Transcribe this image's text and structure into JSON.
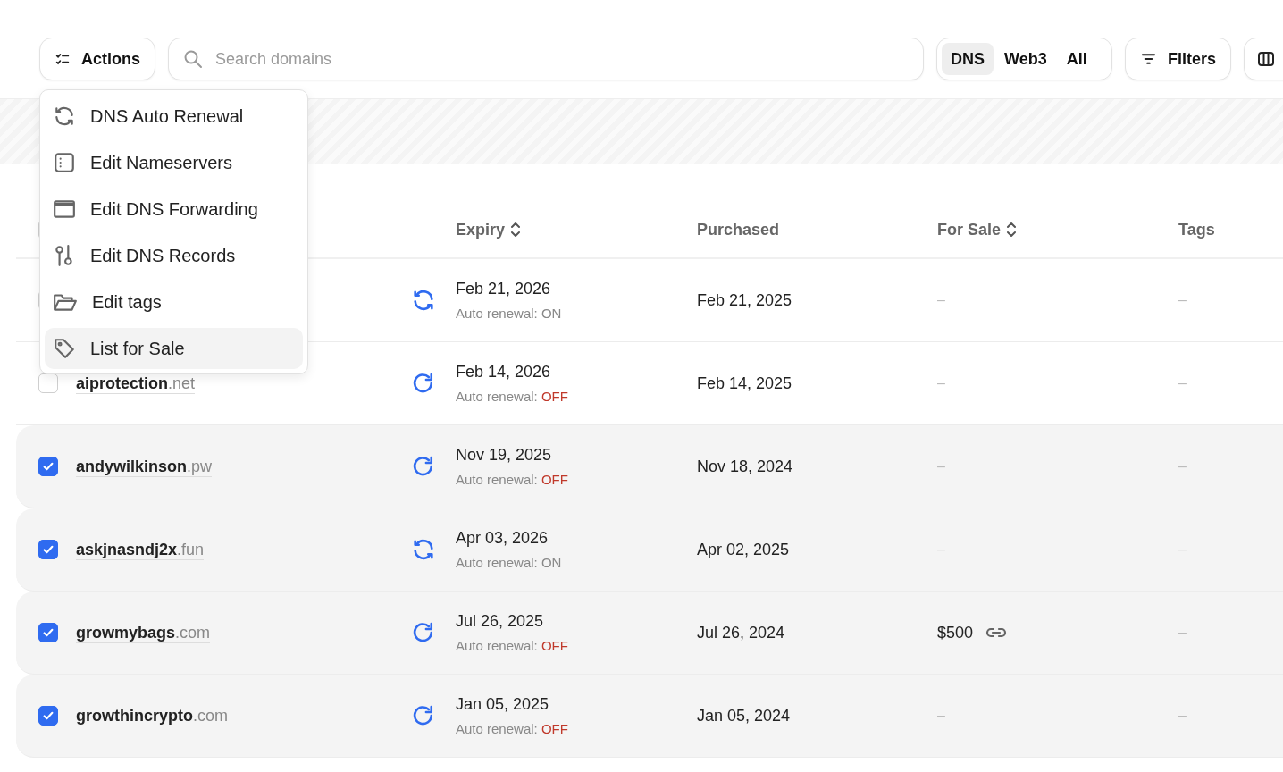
{
  "toolbar": {
    "actions_label": "Actions",
    "search": {
      "placeholder": "Search domains"
    },
    "segments": [
      {
        "label": "DNS",
        "selected": true
      },
      {
        "label": "Web3",
        "selected": false
      },
      {
        "label": "All",
        "selected": false
      }
    ],
    "filters_label": "Filters"
  },
  "actions_menu": {
    "items": [
      {
        "kind": "renew",
        "label": "DNS Auto Renewal",
        "selected": false
      },
      {
        "kind": "nameservers",
        "label": "Edit Nameservers",
        "selected": false
      },
      {
        "kind": "forwarding",
        "label": "Edit DNS Forwarding",
        "selected": false
      },
      {
        "kind": "records",
        "label": "Edit DNS Records",
        "selected": false
      },
      {
        "kind": "tags",
        "label": "Edit tags",
        "selected": false
      },
      {
        "kind": "sale",
        "label": "List for Sale",
        "selected": true
      }
    ]
  },
  "table": {
    "header_checked": false,
    "columns": [
      {
        "label": "Expiry",
        "sortable": true
      },
      {
        "label": "Purchased",
        "sortable": false
      },
      {
        "label": "For Sale",
        "sortable": true
      },
      {
        "label": "Tags",
        "sortable": false
      }
    ],
    "rows": [
      {
        "checked": false,
        "auto_renew": true,
        "expiry": "Feb 21, 2026",
        "renewal_label": "Auto renewal:",
        "renewal_value": "ON",
        "purchased": "Feb 21, 2025",
        "for_sale": "–",
        "tags": "–"
      },
      {
        "checked": false,
        "name": "aiprotection",
        "tld": ".net",
        "auto_renew": false,
        "expiry": "Feb 14, 2026",
        "renewal_label": "Auto renewal:",
        "renewal_value": "OFF",
        "purchased": "Feb 14, 2025",
        "for_sale": "–",
        "tags": "–"
      },
      {
        "checked": true,
        "name": "andywilkinson",
        "tld": ".pw",
        "auto_renew": false,
        "expiry": "Nov 19, 2025",
        "renewal_label": "Auto renewal:",
        "renewal_value": "OFF",
        "purchased": "Nov 18, 2024",
        "for_sale": "–",
        "tags": "–"
      },
      {
        "checked": true,
        "name": "askjnasndj2x",
        "tld": ".fun",
        "auto_renew": true,
        "expiry": "Apr 03, 2026",
        "renewal_label": "Auto renewal:",
        "renewal_value": "ON",
        "purchased": "Apr 02, 2025",
        "for_sale": "–",
        "tags": "–"
      },
      {
        "checked": true,
        "name": "growmybags",
        "tld": ".com",
        "auto_renew": false,
        "expiry": "Jul 26, 2025",
        "renewal_label": "Auto renewal:",
        "renewal_value": "OFF",
        "purchased": "Jul 26, 2024",
        "for_sale": "$500",
        "for_sale_link": true,
        "tags": "–"
      },
      {
        "checked": true,
        "name": "growthincrypto",
        "tld": ".com",
        "auto_renew": false,
        "expiry": "Jan 05, 2025",
        "renewal_label": "Auto renewal:",
        "renewal_value": "OFF",
        "purchased": "Jan 05, 2024",
        "for_sale": "–",
        "tags": "–"
      }
    ]
  }
}
